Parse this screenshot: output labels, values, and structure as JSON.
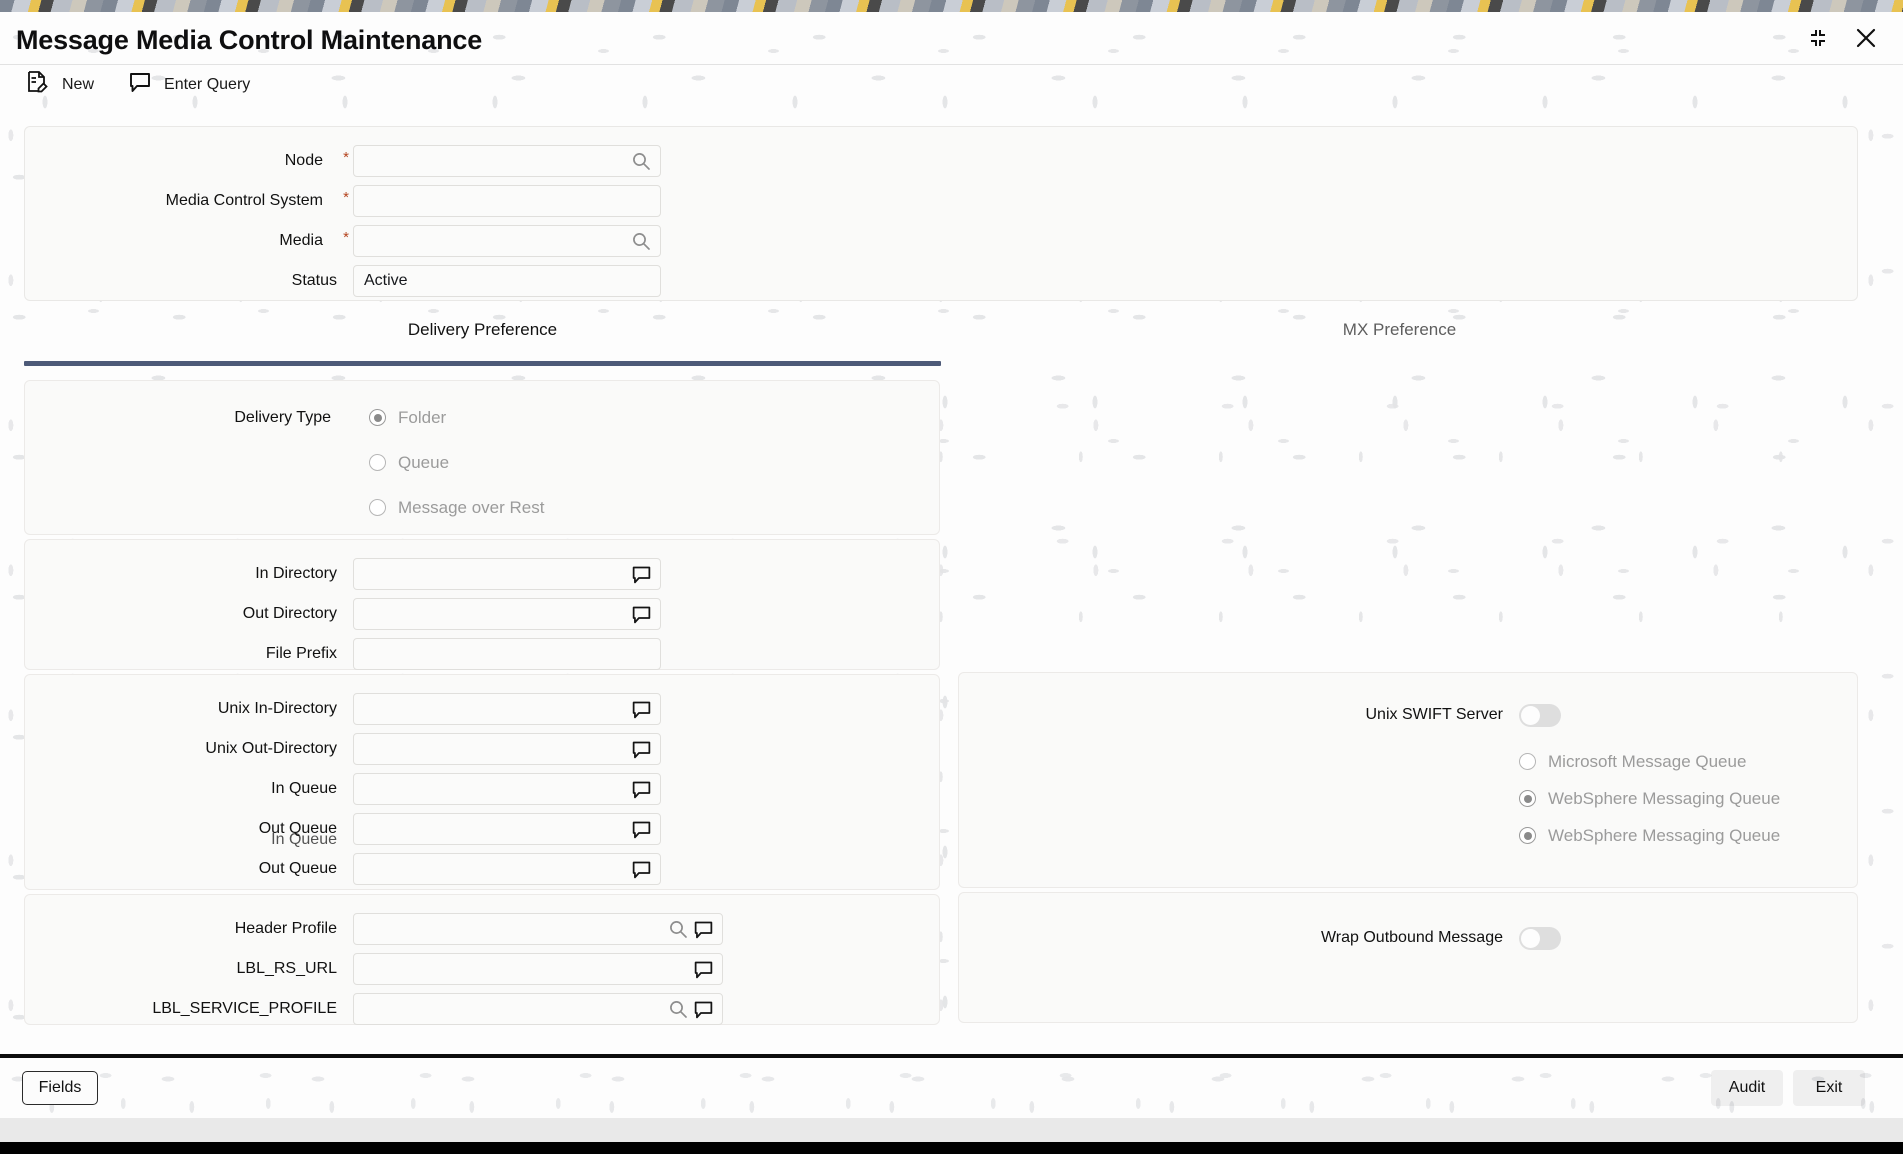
{
  "window": {
    "title": "Message Media Control Maintenance",
    "minimize_icon": "collapse-corners-icon",
    "close_icon": "close-icon"
  },
  "toolbar": {
    "items": [
      {
        "label": "New",
        "icon": "new-document-icon"
      },
      {
        "label": "Enter Query",
        "icon": "speech-bubble-icon"
      }
    ]
  },
  "header_form": {
    "fields": [
      {
        "label": "Node",
        "required": true,
        "value": "",
        "icon": "search-icon"
      },
      {
        "label": "Media Control System",
        "required": true,
        "value": "",
        "icon": ""
      },
      {
        "label": "Media",
        "required": true,
        "value": "",
        "icon": "search-icon"
      },
      {
        "label": "Status",
        "required": false,
        "value": "Active",
        "icon": ""
      }
    ]
  },
  "tabs": [
    {
      "label": "Delivery Preference",
      "active": true
    },
    {
      "label": "MX Preference",
      "active": false
    }
  ],
  "delivery_type": {
    "label": "Delivery Type",
    "options": [
      {
        "label": "Folder",
        "selected": true
      },
      {
        "label": "Queue",
        "selected": false
      },
      {
        "label": "Message over Rest",
        "selected": false
      }
    ]
  },
  "directory_section": {
    "fields": [
      {
        "label": "In Directory",
        "value": "",
        "icons": [
          "speech-bubble-icon"
        ]
      },
      {
        "label": "Out Directory",
        "value": "",
        "icons": [
          "speech-bubble-icon"
        ]
      },
      {
        "label": "File Prefix",
        "value": "",
        "icons": []
      }
    ]
  },
  "queue_section": {
    "fields": [
      {
        "label": "Unix In-Directory",
        "value": "",
        "icons": [
          "speech-bubble-icon"
        ]
      },
      {
        "label": "Unix Out-Directory",
        "value": "",
        "icons": [
          "speech-bubble-icon"
        ]
      },
      {
        "label": "In Queue",
        "value": "",
        "icons": [
          "speech-bubble-icon"
        ]
      },
      {
        "label": "Out Queue",
        "value": "",
        "icons": [
          "speech-bubble-icon"
        ],
        "ghost_overlap": "In Queue"
      },
      {
        "label": "Out Queue",
        "value": "",
        "icons": [
          "speech-bubble-icon"
        ]
      }
    ]
  },
  "profile_section": {
    "fields": [
      {
        "label": "Header Profile",
        "value": "",
        "icons": [
          "search-icon",
          "speech-bubble-icon"
        ]
      },
      {
        "label": "LBL_RS_URL",
        "value": "",
        "icons": [
          "speech-bubble-icon"
        ]
      },
      {
        "label": "LBL_SERVICE_PROFILE",
        "value": "",
        "icons": [
          "search-icon",
          "speech-bubble-icon"
        ]
      }
    ]
  },
  "swift_section": {
    "toggle_label": "Unix SWIFT Server",
    "toggle_on": false,
    "options": [
      {
        "label": "Microsoft Message Queue",
        "selected": false
      },
      {
        "label": "WebSphere Messaging Queue",
        "selected": true
      },
      {
        "label": "WebSphere Messaging Queue",
        "selected": true
      }
    ]
  },
  "wrap_section": {
    "toggle_label": "Wrap Outbound Message",
    "toggle_on": false
  },
  "footer": {
    "fields_label": "Fields",
    "audit_label": "Audit",
    "exit_label": "Exit"
  },
  "colors": {
    "accent_tab": "#4d5a78",
    "required_star": "#b4441f",
    "panel_bg": "#fafaf9"
  }
}
